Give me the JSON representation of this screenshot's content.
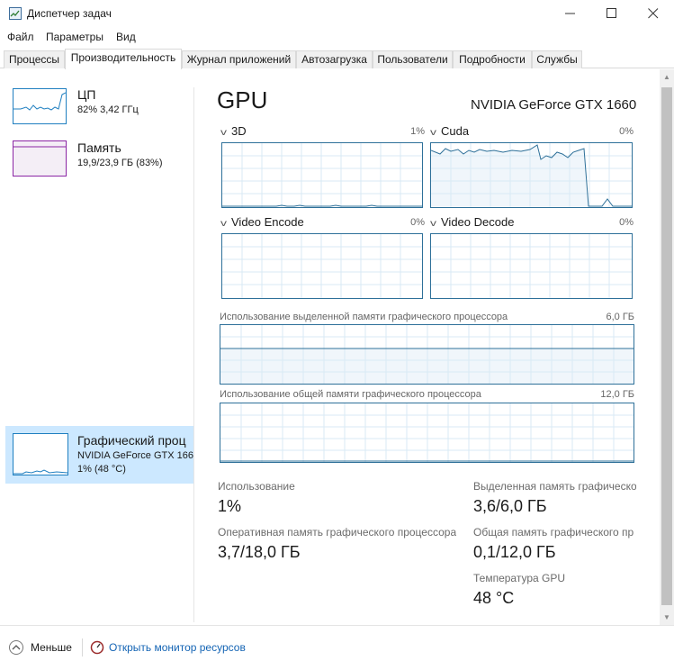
{
  "window": {
    "title": "Диспетчер задач",
    "controls": [
      "minimize-icon",
      "maximize-icon",
      "close-icon"
    ]
  },
  "menu": [
    "Файл",
    "Параметры",
    "Вид"
  ],
  "tabs": [
    {
      "label": "Процессы",
      "active": false
    },
    {
      "label": "Производительность",
      "active": true
    },
    {
      "label": "Журнал приложений",
      "active": false
    },
    {
      "label": "Автозагрузка",
      "active": false
    },
    {
      "label": "Пользователи",
      "active": false
    },
    {
      "label": "Подробности",
      "active": false
    },
    {
      "label": "Службы",
      "active": false
    }
  ],
  "sidebar": {
    "items": [
      {
        "title": "ЦП",
        "line1": "82%  3,42 ГГц",
        "line2": "",
        "color": "#1f7fc0"
      },
      {
        "title": "Память",
        "line1": "19,9/23,9 ГБ (83%)",
        "line2": "",
        "color": "#8b26a4"
      },
      {
        "title": "Графический проц",
        "line1": "NVIDIA GeForce GTX 166",
        "line2": "1% (48 °C)",
        "color": "#1f7fc0",
        "selected": true
      }
    ]
  },
  "main": {
    "title": "GPU",
    "model": "NVIDIA GeForce GTX 1660",
    "engines": [
      {
        "name": "3D",
        "percent": "1%"
      },
      {
        "name": "Cuda",
        "percent": "0%"
      },
      {
        "name": "Video Encode",
        "percent": "0%"
      },
      {
        "name": "Video Decode",
        "percent": "0%"
      }
    ],
    "dedicated_mem": {
      "label": "Использование выделенной памяти графического процессора",
      "max": "6,0 ГБ"
    },
    "shared_mem": {
      "label": "Использование общей памяти графического процессора",
      "max": "12,0 ГБ"
    },
    "stats": {
      "utilization": {
        "label": "Использование",
        "value": "1%"
      },
      "dedicated": {
        "label": "Выделенная память графическо",
        "value": "3,6/6,0 ГБ"
      },
      "gpu_ram": {
        "label": "Оперативная память графического процессора",
        "value": "3,7/18,0 ГБ"
      },
      "shared": {
        "label": "Общая память графического пр",
        "value": "0,1/12,0 ГБ"
      },
      "temperature": {
        "label": "Температура GPU",
        "value": "48 °C"
      }
    }
  },
  "footer": {
    "fewer": "Меньше",
    "resource_monitor": "Открыть монитор ресурсов"
  },
  "colors": {
    "graph_border": "#2e7099",
    "graph_grid": "#d9eaf4",
    "graph_fill": "#f0f6fb",
    "selected_bg": "#cce8ff",
    "link": "#1464b4"
  }
}
